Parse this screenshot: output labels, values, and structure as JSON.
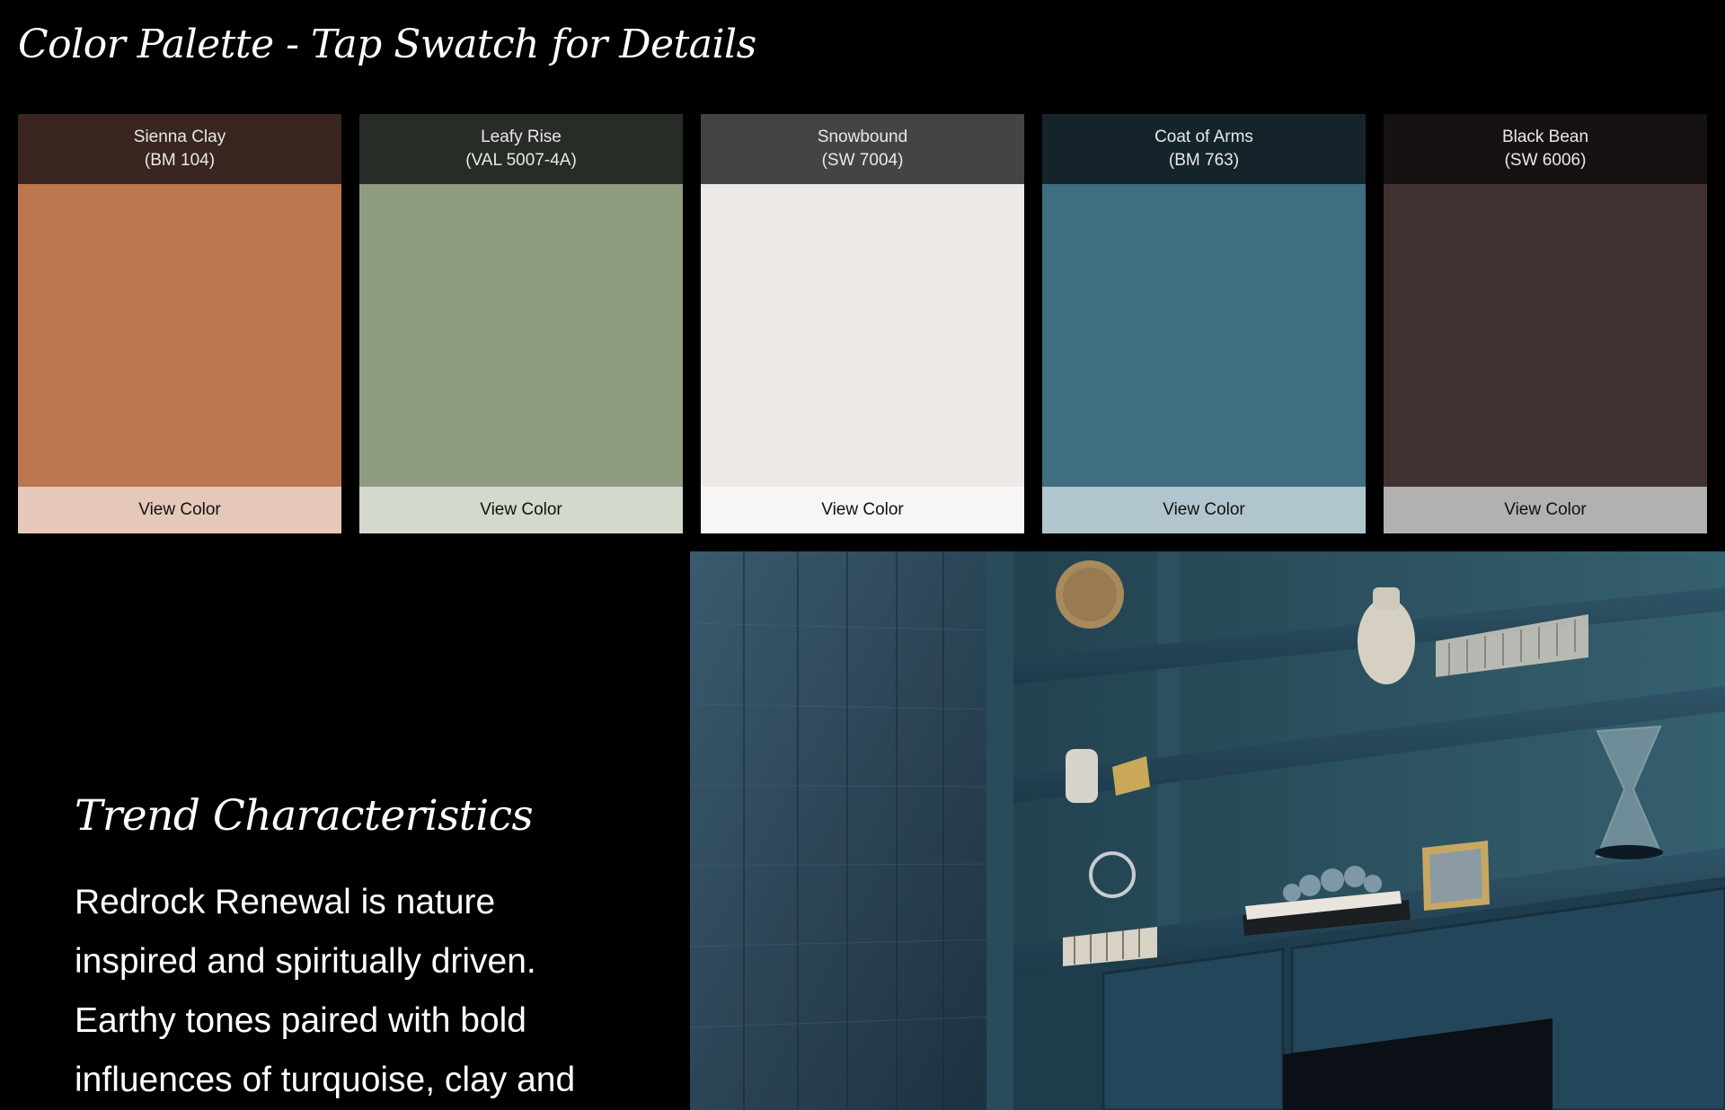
{
  "page": {
    "title": "Color Palette - Tap Swatch for Details"
  },
  "swatches": [
    {
      "name": "Sienna Clay",
      "code": "(BM 104)",
      "button_label": "View Color",
      "header_color": "#392620",
      "chip_color": "#bd7750",
      "button_color": "#e6c8ba"
    },
    {
      "name": "Leafy Rise",
      "code": "(VAL 5007-4A)",
      "button_label": "View Color",
      "header_color": "#272d26",
      "chip_color": "#8f9c80",
      "button_color": "#d3d9cd"
    },
    {
      "name": "Snowbound",
      "code": "(SW 7004)",
      "button_label": "View Color",
      "header_color": "#444444",
      "chip_color": "#ede9e6",
      "button_color": "#f7f6f4"
    },
    {
      "name": "Coat of Arms",
      "code": "(BM 763)",
      "button_label": "View Color",
      "header_color": "#15242b",
      "chip_color": "#3e6e7f",
      "button_color": "#b1c5ce"
    },
    {
      "name": "Black Bean",
      "code": "(SW 6006)",
      "button_label": "View Color",
      "header_color": "#171212",
      "chip_color": "#413231",
      "button_color": "#b3b0b0"
    }
  ],
  "trend": {
    "heading": "Trend Characteristics",
    "body": "Redrock Renewal is nature inspired and spiritually driven. Earthy tones paired with bold influences of turquoise, clay and"
  },
  "photo": {
    "name": "shelving-room-photo",
    "main_color": "#2c4a5c"
  }
}
